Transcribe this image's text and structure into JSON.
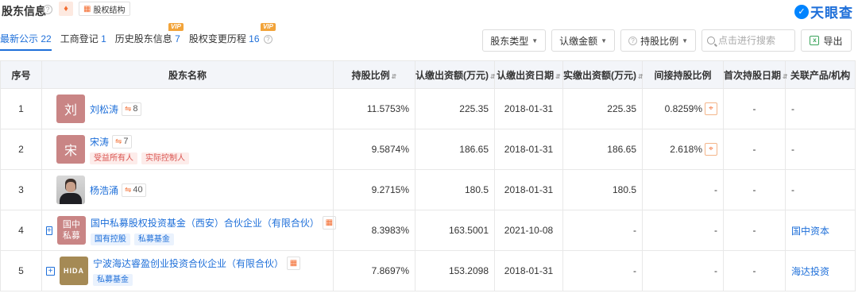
{
  "header": {
    "title": "股东信息",
    "struct_label": "股权结构",
    "brand_name": "天眼查"
  },
  "tabs": [
    {
      "label": "最新公示",
      "count": "22",
      "active": true,
      "vip": false
    },
    {
      "label": "工商登记",
      "count": "1",
      "active": false,
      "vip": false
    },
    {
      "label": "历史股东信息",
      "count": "7",
      "active": false,
      "vip": true
    },
    {
      "label": "股权变更历程",
      "count": "16",
      "active": false,
      "vip": true
    }
  ],
  "vip_label": "VIP",
  "filters": {
    "holder_type": "股东类型",
    "subscribed_amount": "认缴金额",
    "holding_ratio": "持股比例",
    "search_placeholder": "点击进行搜索",
    "export": "导出"
  },
  "table": {
    "headers": {
      "index": "序号",
      "name": "股东名称",
      "ratio": "持股比例",
      "subscribed": "认缴出资额(万元)",
      "sub_date": "认缴出资日期",
      "paid": "实缴出资额(万元)",
      "indirect": "间接持股比例",
      "first_date": "首次持股日期",
      "related": "关联产品/机构"
    },
    "rows": [
      {
        "index": "1",
        "avatar": "刘",
        "name": "刘松涛",
        "chain": "8",
        "tags": [],
        "ratio": "11.5753%",
        "subscribed": "225.35",
        "sub_date": "2018-01-31",
        "paid": "225.35",
        "indirect": "0.8259%",
        "first_date": "-",
        "related": "-"
      },
      {
        "index": "2",
        "avatar": "宋",
        "name": "宋涛",
        "chain": "7",
        "tags": [
          "受益所有人",
          "实际控制人"
        ],
        "ratio": "9.5874%",
        "subscribed": "186.65",
        "sub_date": "2018-01-31",
        "paid": "186.65",
        "indirect": "2.618%",
        "first_date": "-",
        "related": "-"
      },
      {
        "index": "3",
        "avatar": "",
        "name": "杨浩涌",
        "chain": "40",
        "tags": [],
        "ratio": "9.2715%",
        "subscribed": "180.5",
        "sub_date": "2018-01-31",
        "paid": "180.5",
        "indirect": "-",
        "first_date": "-",
        "related": "-"
      },
      {
        "index": "4",
        "avatar": "国中私募",
        "name": "国中私募股权投资基金（西安）合伙企业（有限合伙）",
        "chain": "",
        "tags": [
          "国有控股",
          "私募基金"
        ],
        "ratio": "8.3983%",
        "subscribed": "163.5001",
        "sub_date": "2021-10-08",
        "paid": "-",
        "indirect": "-",
        "first_date": "-",
        "related": "国中资本"
      },
      {
        "index": "5",
        "avatar": "HIDA",
        "name": "宁波海达睿盈创业投资合伙企业（有限合伙）",
        "chain": "",
        "tags": [
          "私募基金"
        ],
        "ratio": "7.8697%",
        "subscribed": "153.2098",
        "sub_date": "2018-01-31",
        "paid": "-",
        "indirect": "-",
        "first_date": "-",
        "related": "海达投资"
      }
    ]
  }
}
